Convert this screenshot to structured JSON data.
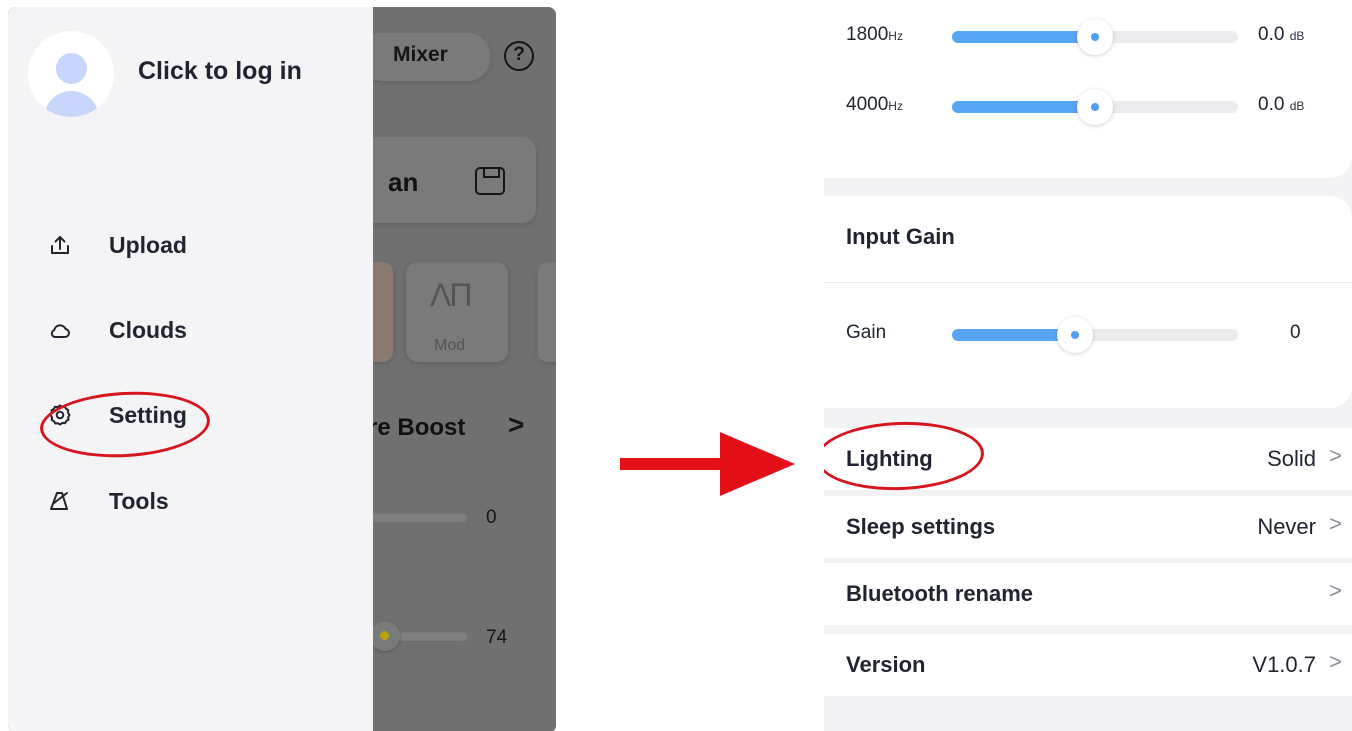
{
  "left": {
    "drawer": {
      "login_text": "Click to log in",
      "menu": [
        {
          "label": "Upload",
          "icon": "upload-icon"
        },
        {
          "label": "Clouds",
          "icon": "cloud-icon"
        },
        {
          "label": "Setting",
          "icon": "gear-icon"
        },
        {
          "label": "Tools",
          "icon": "metronome-icon"
        }
      ]
    },
    "background_app": {
      "mixer_label": "Mixer",
      "help_glyph": "?",
      "preset_fragment": "an",
      "effect_tile_label": "Mod",
      "effect_tile_glyph": "ΛΠ",
      "boost_fragment": "re Boost",
      "boost_chevron": ">",
      "slider_1_value": "0",
      "slider_2_value": "74"
    }
  },
  "right": {
    "eq_bands": [
      {
        "freq": "1800",
        "unit": "Hz",
        "value": "0.0",
        "value_unit": "dB",
        "level": 0.5
      },
      {
        "freq": "4000",
        "unit": "Hz",
        "value": "0.0",
        "value_unit": "dB",
        "level": 0.5
      }
    ],
    "input_gain": {
      "title": "Input Gain",
      "label": "Gain",
      "value": "0",
      "level": 0.43
    },
    "settings": [
      {
        "label": "Lighting",
        "value": "Solid"
      },
      {
        "label": "Sleep settings",
        "value": "Never"
      },
      {
        "label": "Bluetooth rename",
        "value": ""
      },
      {
        "label": "Version",
        "value": "V1.0.7"
      }
    ],
    "chevron": ">"
  },
  "colors": {
    "accent_blue": "#57a6f6",
    "highlight_red": "#d6151f",
    "avatar_tint": "#c9d6fb"
  }
}
